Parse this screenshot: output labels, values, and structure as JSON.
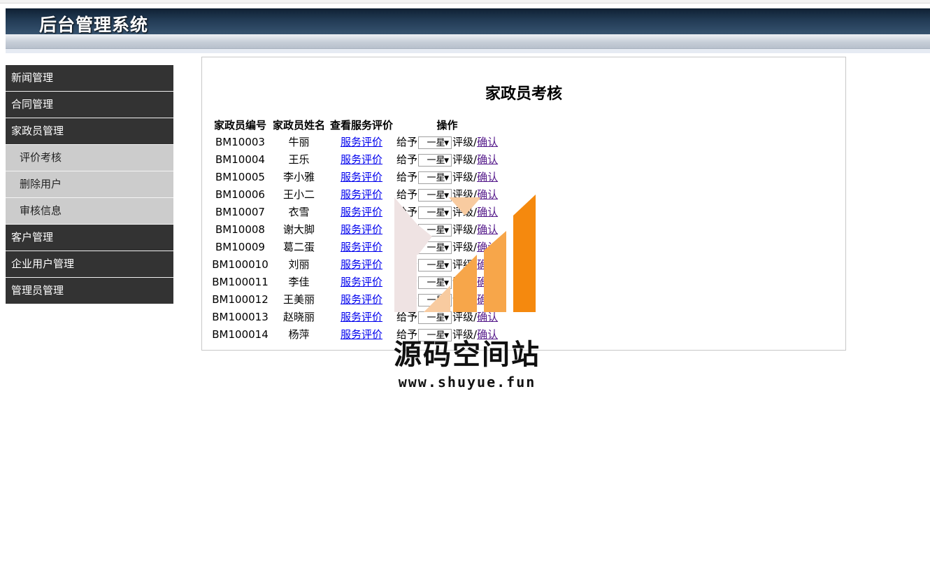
{
  "header": {
    "title": "后台管理系统"
  },
  "sidebar": {
    "items": [
      {
        "label": "新闻管理"
      },
      {
        "label": "合同管理"
      },
      {
        "label": "家政员管理"
      },
      {
        "label": "评价考核"
      },
      {
        "label": "删除用户"
      },
      {
        "label": "审核信息"
      },
      {
        "label": "客户管理"
      },
      {
        "label": "企业用户管理"
      },
      {
        "label": "管理员管理"
      }
    ]
  },
  "main": {
    "title": "家政员考核",
    "columns": [
      "家政员编号",
      "家政员姓名",
      "查看服务评价",
      "操作"
    ],
    "op_prefix": "给予",
    "op_mid": "评级/",
    "rows": [
      {
        "id": "BM10003",
        "name": "牛丽",
        "link": "服务评价",
        "rating": "一星",
        "confirm": "确认"
      },
      {
        "id": "BM10004",
        "name": "王乐",
        "link": "服务评价",
        "rating": "一星",
        "confirm": "确认"
      },
      {
        "id": "BM10005",
        "name": "李小雅",
        "link": "服务评价",
        "rating": "一星",
        "confirm": "确认"
      },
      {
        "id": "BM10006",
        "name": "王小二",
        "link": "服务评价",
        "rating": "一星",
        "confirm": "确认"
      },
      {
        "id": "BM10007",
        "name": "衣雪",
        "link": "服务评价",
        "rating": "一星",
        "confirm": "确认"
      },
      {
        "id": "BM10008",
        "name": "谢大脚",
        "link": "服务评价",
        "rating": "一星",
        "confirm": "确认"
      },
      {
        "id": "BM10009",
        "name": "葛二蛋",
        "link": "服务评价",
        "rating": "一星",
        "confirm": "确认"
      },
      {
        "id": "BM100010",
        "name": "刘丽",
        "link": "服务评价",
        "rating": "一星",
        "confirm": "确认"
      },
      {
        "id": "BM100011",
        "name": "李佳",
        "link": "服务评价",
        "rating": "一星",
        "confirm": "确认"
      },
      {
        "id": "BM100012",
        "name": "王美丽",
        "link": "服务评价",
        "rating": "一星",
        "confirm": "确认"
      },
      {
        "id": "BM100013",
        "name": "赵晓丽",
        "link": "服务评价",
        "rating": "一星",
        "confirm": "确认"
      },
      {
        "id": "BM100014",
        "name": "杨萍",
        "link": "服务评价",
        "rating": "一星",
        "confirm": "确认"
      }
    ]
  },
  "watermark": {
    "text": "源码空间站",
    "url": "www.shuyue.fun",
    "colors": {
      "light": "#efe3e3",
      "peach": "#f8cba0",
      "orange": "#f7a64a",
      "dark_orange": "#f5890e"
    }
  }
}
